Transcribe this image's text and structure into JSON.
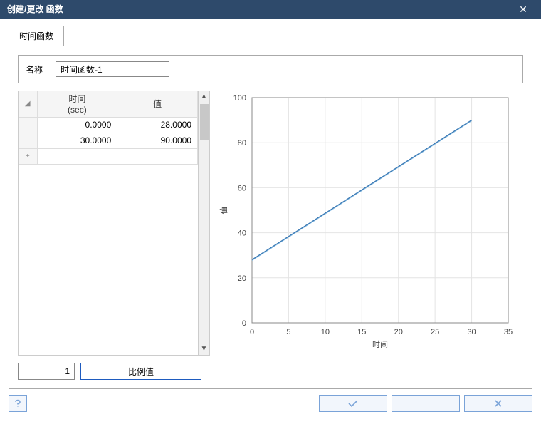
{
  "window": {
    "title": "创建/更改 函数"
  },
  "tabs": {
    "items": [
      {
        "label": "时间函数"
      }
    ]
  },
  "name_row": {
    "label": "名称",
    "value": "时间函数-1"
  },
  "table": {
    "columns": [
      "时间\n(sec)",
      "值"
    ],
    "rows": [
      {
        "time": "0.0000",
        "value": "28.0000"
      },
      {
        "time": "30.0000",
        "value": "90.0000"
      }
    ],
    "add_marker": "+"
  },
  "chart_data": {
    "type": "line",
    "x": [
      0,
      30
    ],
    "y": [
      28,
      90
    ],
    "xlabel": "时间",
    "ylabel": "值",
    "xlim": [
      0,
      35
    ],
    "ylim": [
      0,
      100
    ],
    "xticks": [
      0,
      5,
      10,
      15,
      20,
      25,
      30,
      35
    ],
    "yticks": [
      0,
      20,
      40,
      60,
      80,
      100
    ]
  },
  "scale": {
    "value": "1",
    "button": "比例值"
  },
  "footer": {
    "help_icon": "?",
    "ok_icon": "check",
    "cancel_icon": "x"
  }
}
